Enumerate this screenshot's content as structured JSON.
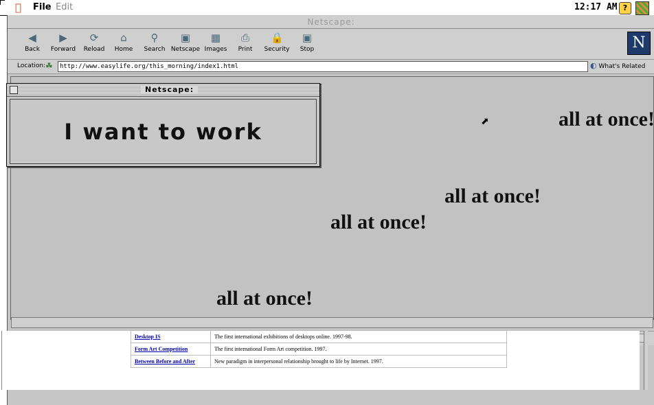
{
  "menubar": {
    "file": "File",
    "edit": "Edit",
    "clock": "12:17 AM",
    "help": "?"
  },
  "window": {
    "title": "Netscape:"
  },
  "toolbar": {
    "buttons": [
      {
        "label": "Back",
        "icon": "back-arrow-icon"
      },
      {
        "label": "Forward",
        "icon": "forward-arrow-icon"
      },
      {
        "label": "Reload",
        "icon": "reload-icon"
      },
      {
        "label": "Home",
        "icon": "home-icon"
      },
      {
        "label": "Search",
        "icon": "search-icon"
      },
      {
        "label": "Netscape",
        "icon": "netscape-icon"
      },
      {
        "label": "Images",
        "icon": "images-icon"
      },
      {
        "label": "Print",
        "icon": "print-icon"
      },
      {
        "label": "Security",
        "icon": "security-icon"
      },
      {
        "label": "Stop",
        "icon": "stop-icon"
      }
    ],
    "logo": "N"
  },
  "location": {
    "label": "Location:",
    "url": "http://www.easylife.org/this_morning/index1.html",
    "related": "What's Related"
  },
  "content": {
    "phrase": "all at once!"
  },
  "popup": {
    "title": "Netscape:",
    "message": "I want to work"
  },
  "under_page": {
    "rows": [
      {
        "link": "Desktop IS",
        "desc": "The first international exhibitions of desktops online. 1997-98."
      },
      {
        "link": "Form Art Competition",
        "desc": "The first international Form Art competition. 1997."
      },
      {
        "link": "Between Before and After",
        "desc": "New paradigm in interpersonal relationship brought to life by Internet. 1997."
      }
    ]
  },
  "colors": {
    "window_bg": "#c6c6c6",
    "content_bg": "#c2c2c2",
    "link": "#0000aa",
    "logo_bg": "#1e3a6a"
  }
}
